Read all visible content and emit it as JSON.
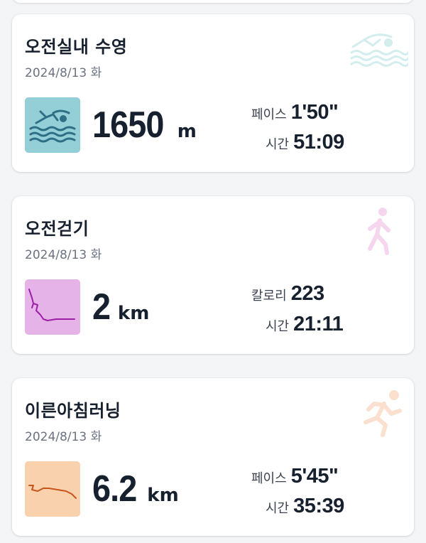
{
  "activities": [
    {
      "title": "오전실내 수영",
      "date": "2024/8/13 화",
      "value": "1650",
      "unit": "m",
      "stat1": {
        "label": "페이스",
        "value": "1'50\""
      },
      "stat2": {
        "label": "시간",
        "value": "51:09"
      },
      "icon": "swimmer-icon",
      "thumb_color": "#94cfd7"
    },
    {
      "title": "오전걷기",
      "date": "2024/8/13 화",
      "value": "2",
      "unit": "km",
      "stat1": {
        "label": "칼로리",
        "value": "223"
      },
      "stat2": {
        "label": "시간",
        "value": "21:11"
      },
      "icon": "walker-icon",
      "thumb_color": "#e6b3e9"
    },
    {
      "title": "이른아침러닝",
      "date": "2024/8/13 화",
      "value": "6.2",
      "unit": "km",
      "stat1": {
        "label": "페이스",
        "value": "5'45\""
      },
      "stat2": {
        "label": "시간",
        "value": "35:39"
      },
      "icon": "runner-icon",
      "thumb_color": "#f9d2ad"
    }
  ],
  "colors": {
    "swim_accent": "#2f6f86",
    "walk_accent": "#9b1fa7",
    "run_accent": "#c9541c",
    "text_primary": "#17202e",
    "text_secondary": "#6b7280"
  }
}
